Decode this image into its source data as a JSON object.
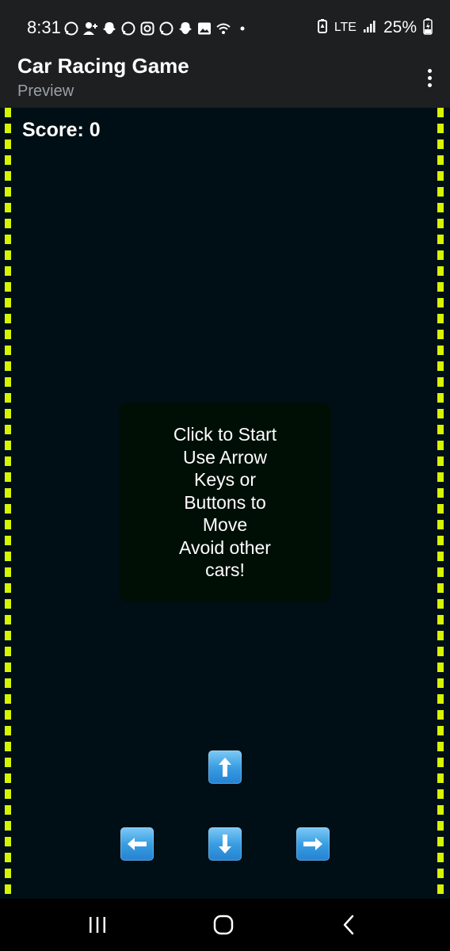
{
  "status_bar": {
    "time": "8:31",
    "network": "LTE",
    "battery": "25%",
    "left_icons": [
      "whatsapp-icon",
      "add-contact-icon",
      "snapchat-icon",
      "whatsapp-icon",
      "instagram-icon",
      "whatsapp-icon",
      "snapchat-icon",
      "gallery-icon",
      "wifi-icon",
      "dot-icon"
    ],
    "right_icons": [
      "battery-saver-icon",
      "signal-icon",
      "battery-charging-icon"
    ]
  },
  "app_bar": {
    "title": "Car Racing Game",
    "subtitle": "Preview",
    "menu_icon": "more-vertical-icon"
  },
  "game": {
    "score_label": "Score: 0",
    "start_lines": [
      "Click to Start",
      "Use Arrow",
      "Keys or",
      "Buttons to",
      "Move",
      "Avoid other",
      "cars!"
    ],
    "controls": {
      "up": "arrow-up-icon",
      "left": "arrow-left-icon",
      "down": "arrow-down-icon",
      "right": "arrow-right-icon"
    },
    "colors": {
      "background": "#000f15",
      "lane_border": "#d6f500",
      "panel": "#000f06",
      "button": "#3a9ee3"
    }
  },
  "nav_bar": {
    "recents": "recents-icon",
    "home": "home-icon",
    "back": "back-icon"
  }
}
